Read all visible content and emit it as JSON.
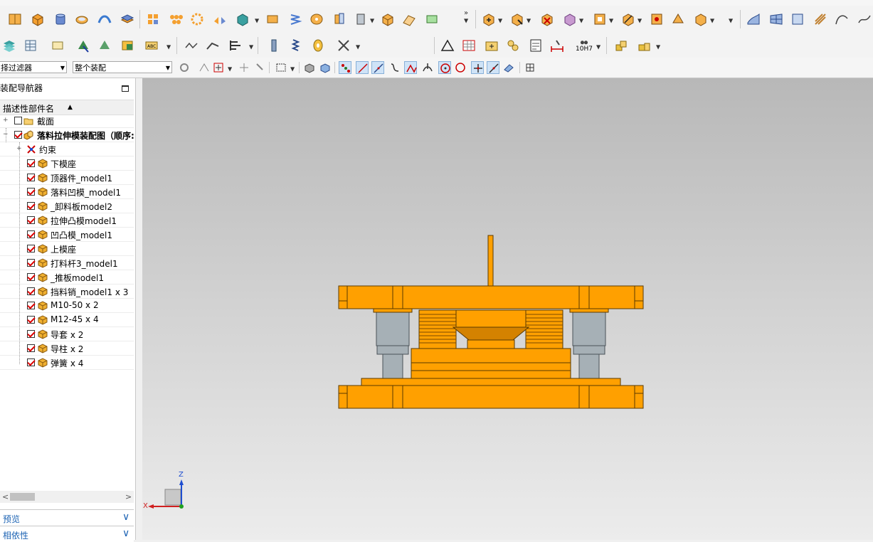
{
  "filter": {
    "selection_filter": "择过滤器",
    "assembly_scope": "整个装配"
  },
  "toolbar": {
    "fit_tolerance": "10H7"
  },
  "navigator": {
    "title": "装配导航器",
    "column_header": "描述性部件名",
    "nodes": [
      {
        "label": "截面",
        "checked": false,
        "icon": "folder-icon"
      },
      {
        "label": "落料拉伸模装配图（顺序:",
        "checked": true,
        "icon": "assembly-icon"
      },
      {
        "label": "约束",
        "checked": null,
        "icon": "constraint-icon"
      },
      {
        "label": "下模座",
        "checked": true,
        "icon": "part-icon"
      },
      {
        "label": "顶器件_model1",
        "checked": true,
        "icon": "part-icon"
      },
      {
        "label": "落料凹模_model1",
        "checked": true,
        "icon": "part-icon"
      },
      {
        "label": "_卸料板model2",
        "checked": true,
        "icon": "part-icon"
      },
      {
        "label": "拉伸凸模model1",
        "checked": true,
        "icon": "part-icon"
      },
      {
        "label": "凹凸模_model1",
        "checked": true,
        "icon": "part-icon"
      },
      {
        "label": "上模座",
        "checked": true,
        "icon": "part-icon"
      },
      {
        "label": "打料杆3_model1",
        "checked": true,
        "icon": "part-icon"
      },
      {
        "label": "_推板model1",
        "checked": true,
        "icon": "part-icon"
      },
      {
        "label": "挡料销_model1 x 3",
        "checked": true,
        "icon": "part-icon"
      },
      {
        "label": "M10-50 x 2",
        "checked": true,
        "icon": "part-icon"
      },
      {
        "label": "M12-45 x 4",
        "checked": true,
        "icon": "part-icon"
      },
      {
        "label": "导套 x 2",
        "checked": true,
        "icon": "part-icon"
      },
      {
        "label": "导柱 x 2",
        "checked": true,
        "icon": "part-icon"
      },
      {
        "label": "弹簧 x 4",
        "checked": true,
        "icon": "part-icon"
      }
    ]
  },
  "panels": {
    "preview": "预览",
    "dependencies": "相依性"
  },
  "triad": {
    "z_label": "Z",
    "x_label": "X"
  },
  "colors": {
    "part": "#ffa000",
    "part_edge": "#5a3a00",
    "steel": "#a6b0b6",
    "accent": "#1e64b4"
  }
}
